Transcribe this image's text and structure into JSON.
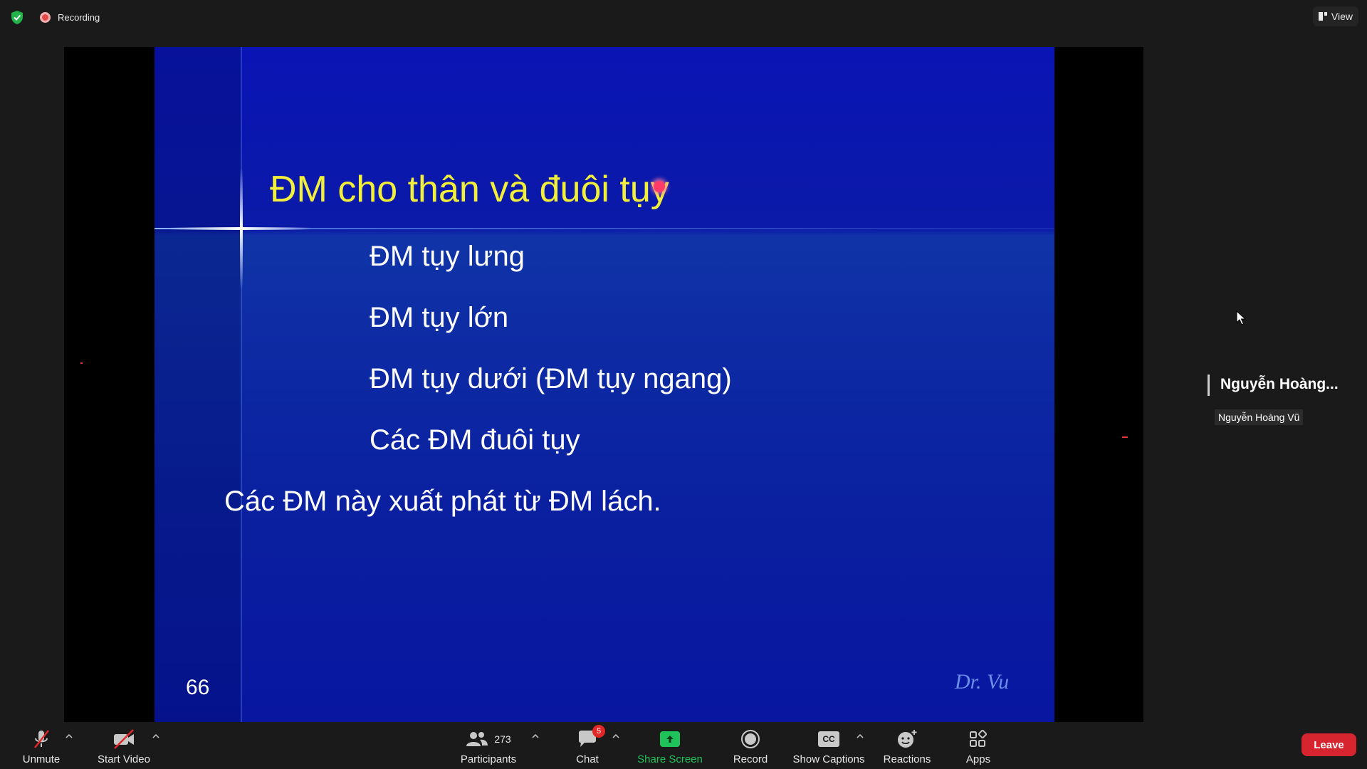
{
  "topbar": {
    "security_icon": "shield-check-icon",
    "recording_label": "Recording",
    "view_label": "View"
  },
  "slide": {
    "title": "ĐM cho thân và đuôi tụy",
    "bullets": [
      "ĐM tụy lưng",
      "ĐM tụy lớn",
      "ĐM tụy dưới (ĐM tụy ngang)",
      "Các ĐM đuôi tụy",
      "Các ĐM này xuất phát từ ĐM lách."
    ],
    "page_number": "66",
    "signature": "Dr. Vu",
    "colors": {
      "background": "#0a1fa0",
      "title": "#f2ef3a",
      "text": "#ffffff",
      "signature": "#6d8ee8"
    }
  },
  "participant": {
    "display_name": "Nguyễn Hoàng...",
    "name_label": "Nguyễn Hoàng Vũ"
  },
  "toolbar": {
    "unmute_label": "Unmute",
    "start_video_label": "Start Video",
    "participants_label": "Participants",
    "participants_count": "273",
    "chat_label": "Chat",
    "chat_badge": "5",
    "share_screen_label": "Share Screen",
    "record_label": "Record",
    "captions_label": "Show Captions",
    "captions_icon_text": "CC",
    "reactions_label": "Reactions",
    "apps_label": "Apps",
    "leave_label": "Leave",
    "colors": {
      "share_green": "#1fc35a",
      "leave_red": "#d6252f",
      "label": "#e8e8e8"
    }
  }
}
